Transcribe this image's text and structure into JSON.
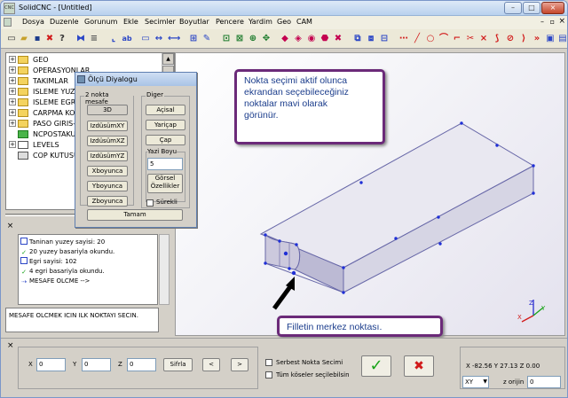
{
  "window": {
    "title": "SolidCNC - [Untitled]",
    "app_icon": "CNC"
  },
  "menu": [
    "Dosya",
    "Duzenle",
    "Gorunum",
    "Ekle",
    "Secimler",
    "Boyutlar",
    "Pencere",
    "Yardim",
    "Geo",
    "CAM"
  ],
  "tree": {
    "items": [
      "GEO",
      "OPERASYONLAR",
      "TAKIMLAR",
      "ISLEME YUZE",
      "ISLEME EGRIS",
      "CARPMA KO",
      "PASO GIRIS-C",
      "NCPOSTAKU",
      "LEVELS",
      "COP KUTUSU"
    ]
  },
  "log": {
    "lines": [
      {
        "icon": "doc-icon",
        "text": "Taninan yuzey sayisi: 20"
      },
      {
        "icon": "check-icon",
        "text": "20  yuzey basariyla okundu."
      },
      {
        "icon": "doc-icon",
        "text": "Egri sayisi:  102"
      },
      {
        "icon": "check-icon",
        "text": "4 egri basariyla okundu."
      },
      {
        "icon": "arrow-icon",
        "text": "MESAFE OLCME -->"
      }
    ],
    "prompt": "MESAFE OLCMEK ICIN ILK NOKTAYI SECIN."
  },
  "dialog": {
    "title": "Ölçü Diyalogu",
    "group_distance": "2 nokta mesafe",
    "btn_3d": "3D",
    "btn_xy": "IzdüsümXY",
    "btn_xz": "IzdüsümXZ",
    "btn_yz": "IzdüsümYZ",
    "btn_x": "Xboyunca",
    "btn_y": "Yboyunca",
    "btn_z": "Zboyunca",
    "group_other": "Diger",
    "btn_angle": "Açisal",
    "btn_radius": "Yariçap",
    "btn_diameter": "Çap",
    "text_size_label": "Yazi Boyu",
    "text_size_value": "5",
    "btn_visual_1": "Görsel",
    "btn_visual_2": "Özellikler",
    "continuous_label": "Sürekli",
    "btn_ok": "Tamam"
  },
  "callouts": {
    "top_lines": [
      "Nokta seçimi aktif olunca",
      "ekrandan seçebileceğiniz",
      "noktalar mavi olarak",
      "görünür."
    ],
    "bottom": "Filletin merkez noktası."
  },
  "axes": {
    "x": "X",
    "y": "Y",
    "z": "Z"
  },
  "bottom": {
    "x_label": "X",
    "x_value": "0",
    "y_label": "Y",
    "y_value": "0",
    "z_label": "Z",
    "z_value": "0",
    "reset": "Sifrla",
    "prev": "<",
    "next": ">",
    "free_point": "Serbest Nokta Secimi",
    "all_corners": "Tüm köseler seçilebilsin",
    "coords": "X -82.56  Y 27.13  Z 0.00",
    "plane": "XY",
    "origin_label": "z orijin",
    "origin_value": "0"
  },
  "colors": {
    "accent_callout": "#6b2a79",
    "callout_text": "#1b3d8c",
    "ok_green": "#17a317",
    "cancel_red": "#d11b1b",
    "point_blue": "#1f2fd6"
  }
}
